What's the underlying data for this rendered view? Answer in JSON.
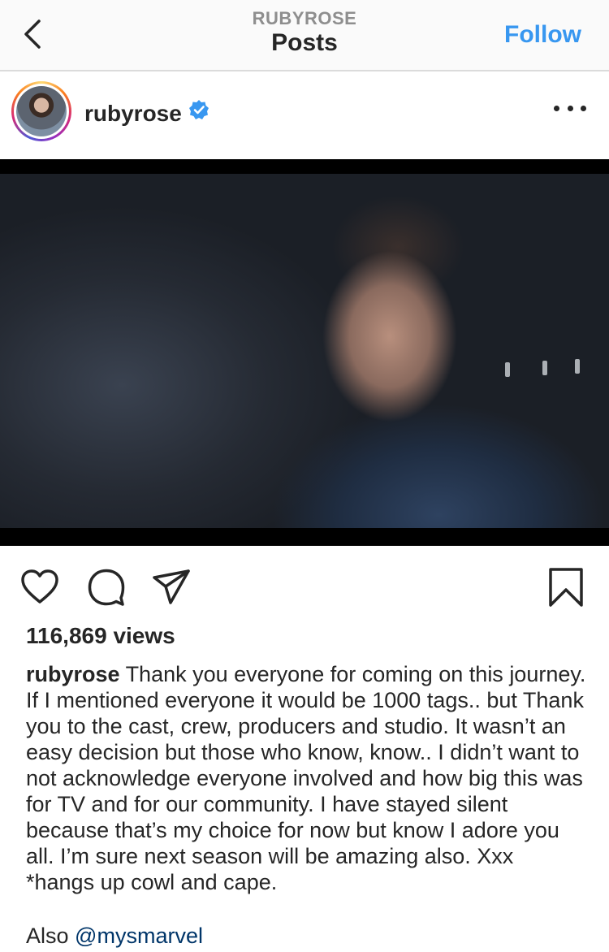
{
  "header": {
    "subtitle": "RUBYROSE",
    "title": "Posts",
    "follow_label": "Follow",
    "back_icon": "chevron-left-icon"
  },
  "post": {
    "username": "rubyrose",
    "verified": true,
    "more_icon": "more-horizontal-icon",
    "media_type": "video",
    "views": "116,869 views",
    "caption_user": "rubyrose",
    "caption_text": "Thank you everyone for coming on this journey. If I mentioned everyone it would be 1000 tags.. but Thank you to the cast, crew, producers and studio. It wasn’t an easy decision but those who know, know.. I didn’t want to not acknowledge everyone involved and how big this was for TV and for our community. I have stayed silent because that’s my choice for now but know I adore you all. I’m sure next season will be amazing also. Xxx *hangs up cowl and cape.",
    "also_label": "Also",
    "mention": "@mysmarvel"
  },
  "actions": {
    "like_icon": "heart-icon",
    "comment_icon": "comment-icon",
    "share_icon": "paper-plane-icon",
    "save_icon": "bookmark-icon"
  },
  "colors": {
    "accent": "#3897f0",
    "verified": "#3897f0",
    "text": "#262626",
    "muted": "#8e8e8e"
  }
}
